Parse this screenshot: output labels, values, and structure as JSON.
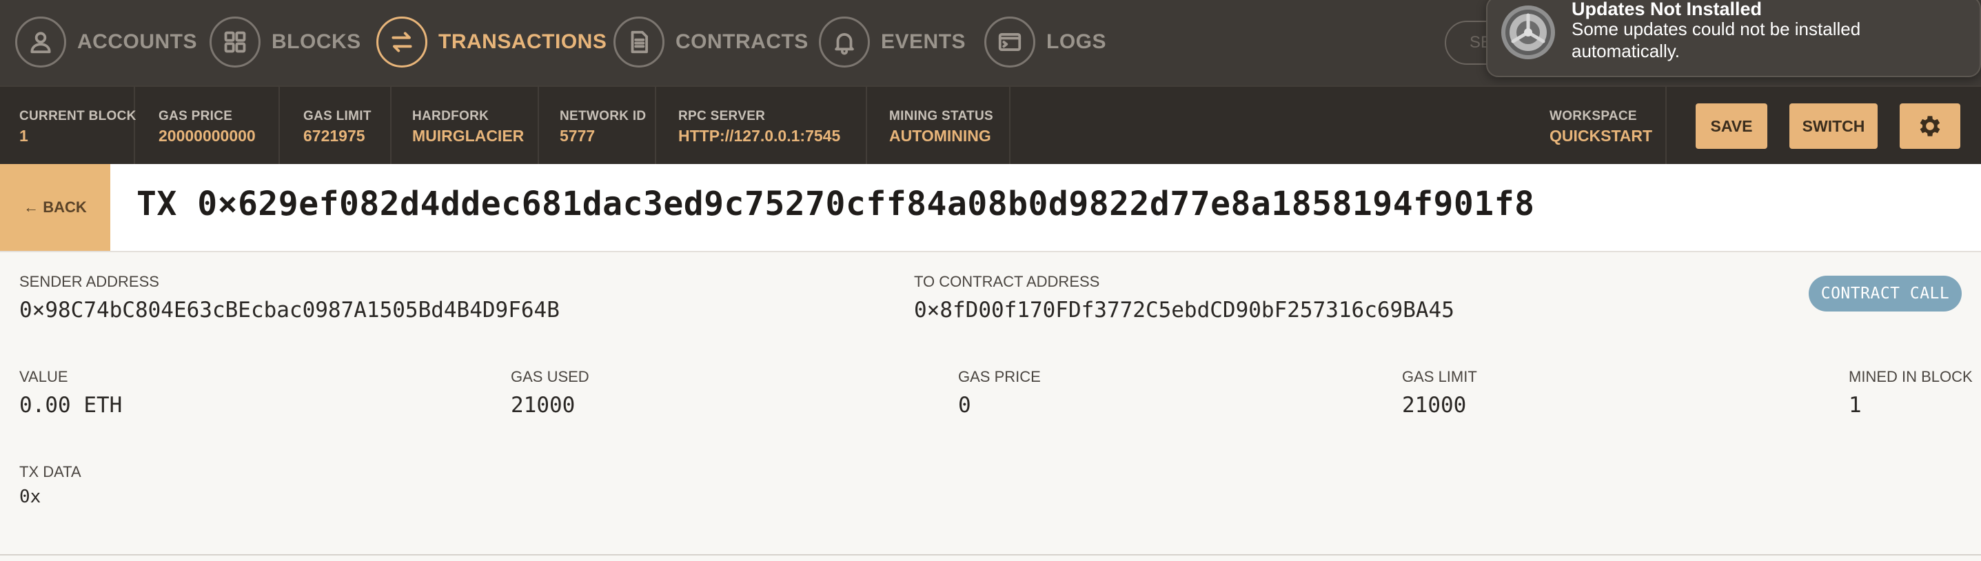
{
  "nav": {
    "items": [
      {
        "label": "ACCOUNTS",
        "icon": "person-icon",
        "active": false
      },
      {
        "label": "BLOCKS",
        "icon": "grid-icon",
        "active": false
      },
      {
        "label": "TRANSACTIONS",
        "icon": "swap-arrows-icon",
        "active": true
      },
      {
        "label": "CONTRACTS",
        "icon": "document-icon",
        "active": false
      },
      {
        "label": "EVENTS",
        "icon": "bell-icon",
        "active": false
      },
      {
        "label": "LOGS",
        "icon": "terminal-icon",
        "active": false
      }
    ],
    "search_placeholder": "SEA"
  },
  "notification": {
    "title": "Updates Not Installed",
    "body": "Some updates could not be installed automatically."
  },
  "status": {
    "current_block": {
      "label": "CURRENT BLOCK",
      "value": "1"
    },
    "gas_price": {
      "label": "GAS PRICE",
      "value": "20000000000"
    },
    "gas_limit": {
      "label": "GAS LIMIT",
      "value": "6721975"
    },
    "hardfork": {
      "label": "HARDFORK",
      "value": "MUIRGLACIER"
    },
    "network_id": {
      "label": "NETWORK ID",
      "value": "5777"
    },
    "rpc_server": {
      "label": "RPC SERVER",
      "value": "HTTP://127.0.0.1:7545"
    },
    "mining_status": {
      "label": "MINING STATUS",
      "value": "AUTOMINING"
    },
    "workspace": {
      "label": "WORKSPACE",
      "value": "QUICKSTART"
    },
    "save_label": "SAVE",
    "switch_label": "SWITCH",
    "settings_icon": "gear-icon"
  },
  "title": {
    "back_label": "← BACK",
    "tx_hash": "TX 0×629ef082d4ddec681dac3ed9c75270cff84a08b0d9822d77e8a1858194f901f8"
  },
  "details": {
    "sender": {
      "label": "SENDER ADDRESS",
      "value": "0×98C74bC804E63cBEcbac0987A1505Bd4B4D9F64B"
    },
    "to_contract": {
      "label": "TO CONTRACT ADDRESS",
      "value": "0×8fD00f170FDf3772C5ebdCD90bF257316c69BA45"
    },
    "badge": "CONTRACT CALL",
    "value": {
      "label": "VALUE",
      "value": "0.00 ETH"
    },
    "gas_used": {
      "label": "GAS USED",
      "value": "21000"
    },
    "gas_price": {
      "label": "GAS PRICE",
      "value": "0"
    },
    "gas_limit": {
      "label": "GAS LIMIT",
      "value": "21000"
    },
    "mined_in_block": {
      "label": "MINED IN BLOCK",
      "value": "1"
    },
    "tx_data": {
      "label": "TX DATA",
      "value": "0x"
    }
  },
  "colors": {
    "accent": "#e8b57a",
    "nav_bg": "#3e3a36",
    "status_bg": "#312d29",
    "badge": "#7fa6bb"
  }
}
